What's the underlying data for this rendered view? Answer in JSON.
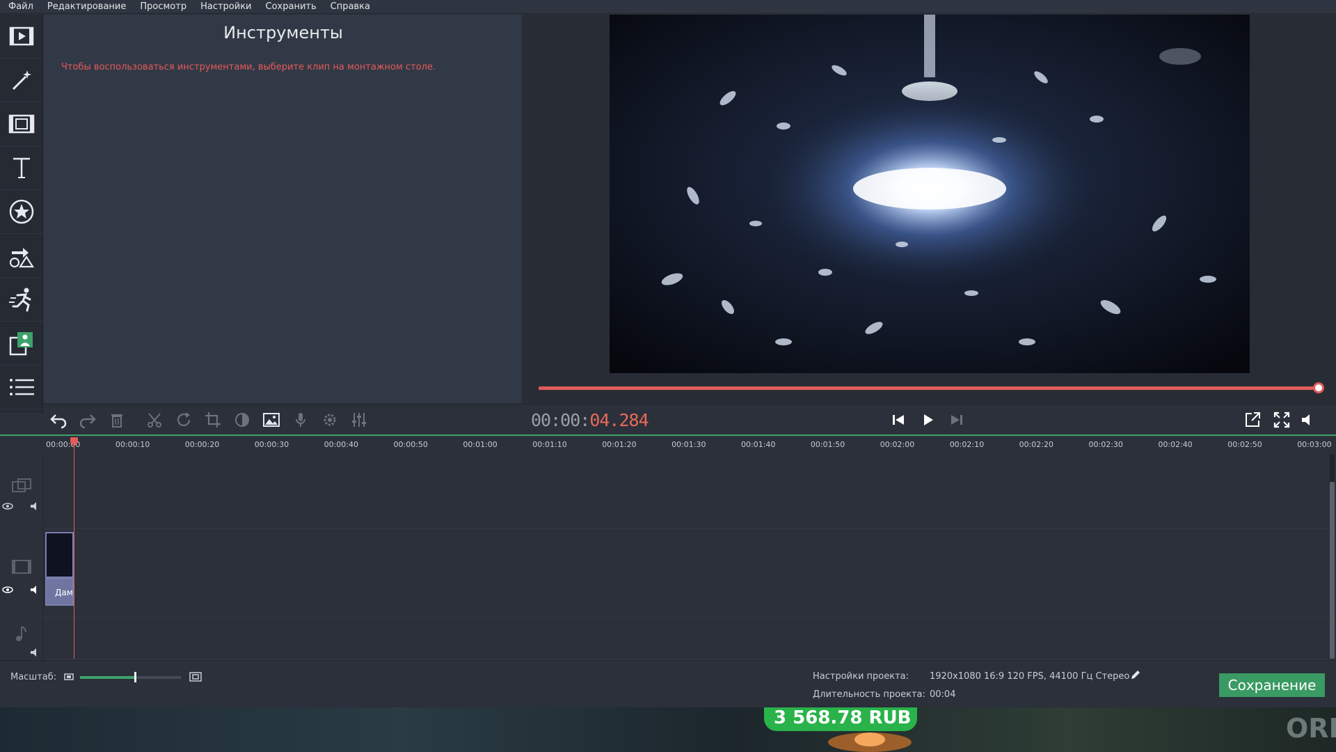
{
  "menu": [
    "Файл",
    "Редактирование",
    "Просмотр",
    "Настройки",
    "Сохранить",
    "Справка"
  ],
  "rail_icons": [
    "import-media-icon",
    "magic-wand-icon",
    "transitions-icon",
    "text-icon",
    "stickers-icon",
    "shapes-icon",
    "motion-icon",
    "picture-in-picture-icon",
    "more-list-icon"
  ],
  "tools": {
    "title": "Инструменты",
    "hint": "Чтобы воспользоваться инструментами, выберите клип на монтажном столе."
  },
  "player": {
    "progress_fraction": 0.996,
    "timecode_dim": "00:00:",
    "timecode_active": "04.284"
  },
  "toolbar_icons": [
    "undo-icon",
    "redo-icon",
    "delete-icon",
    "cut-icon",
    "rotate-icon",
    "crop-icon",
    "color-adjust-icon",
    "image-edit-icon",
    "record-voice-icon",
    "settings-gear-icon",
    "equalizer-icon"
  ],
  "ruler_ticks": [
    "00:00:00",
    "00:00:10",
    "00:00:20",
    "00:00:30",
    "00:00:40",
    "00:00:50",
    "00:01:00",
    "00:01:10",
    "00:01:20",
    "00:01:30",
    "00:01:40",
    "00:01:50",
    "00:02:00",
    "00:02:10",
    "00:02:20",
    "00:02:30",
    "00:02:40",
    "00:02:50",
    "00:03:00"
  ],
  "clip": {
    "label": "Дам"
  },
  "bottom": {
    "scale_label": "Масштаб:",
    "scale_fraction": 0.54,
    "project_settings_label": "Настройки проекта:",
    "project_settings_value": "1920x1080 16:9 120 FPS, 44100 Гц Стерео",
    "project_duration_label": "Длительность проекта:",
    "project_duration_value": "00:04",
    "save_button": "Сохранение"
  },
  "desktop": {
    "balance": "3 568.78 RUB",
    "watermark": "ORBO"
  },
  "colors": {
    "accent_red": "#e25b5b",
    "accent_green": "#3da26a"
  }
}
